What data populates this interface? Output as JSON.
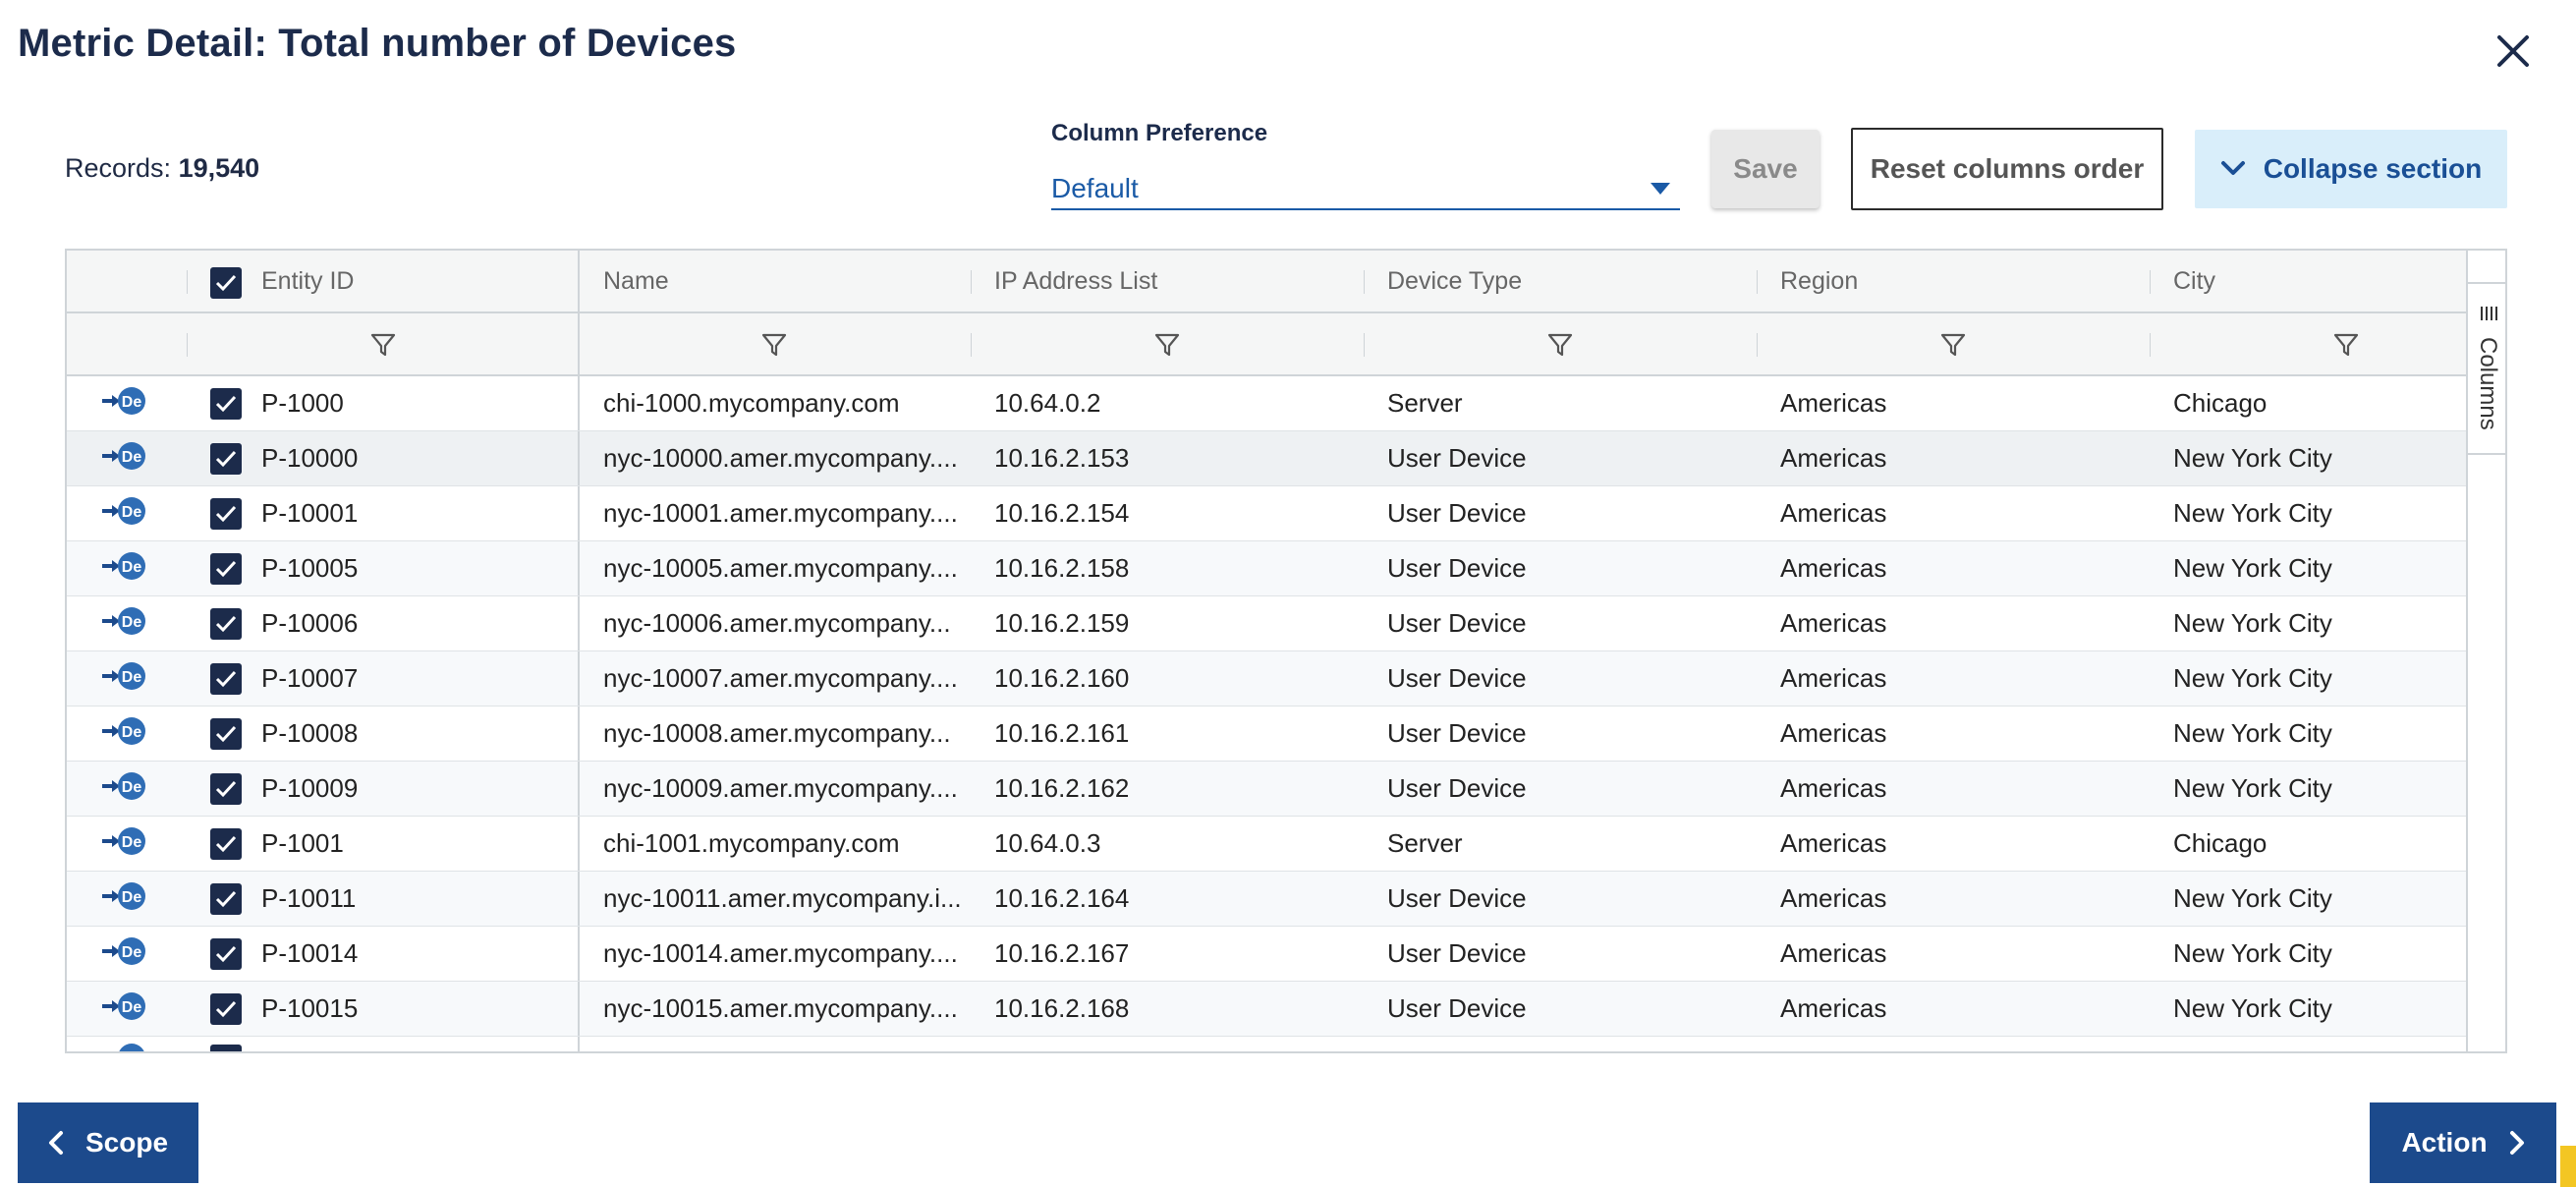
{
  "dialog": {
    "title": "Metric Detail: Total number of Devices",
    "close_icon": "close-icon"
  },
  "records": {
    "label": "Records:",
    "count": "19,540"
  },
  "column_preference": {
    "label": "Column Preference",
    "value": "Default"
  },
  "toolbar": {
    "save_label": "Save",
    "reset_label": "Reset columns order",
    "collapse_label": "Collapse section"
  },
  "grid": {
    "columns": [
      "Entity ID",
      "Name",
      "IP Address List",
      "Device Type",
      "Region",
      "City"
    ],
    "side_panel_label": "Columns",
    "rows": [
      [
        "P-1000",
        "chi-1000.mycompany.com",
        "10.64.0.2",
        "Server",
        "Americas",
        "Chicago"
      ],
      [
        "P-10000",
        "nyc-10000.amer.mycompany....",
        "10.16.2.153",
        "User Device",
        "Americas",
        "New York City"
      ],
      [
        "P-10001",
        "nyc-10001.amer.mycompany....",
        "10.16.2.154",
        "User Device",
        "Americas",
        "New York City"
      ],
      [
        "P-10005",
        "nyc-10005.amer.mycompany....",
        "10.16.2.158",
        "User Device",
        "Americas",
        "New York City"
      ],
      [
        "P-10006",
        "nyc-10006.amer.mycompany...",
        "10.16.2.159",
        "User Device",
        "Americas",
        "New York City"
      ],
      [
        "P-10007",
        "nyc-10007.amer.mycompany....",
        "10.16.2.160",
        "User Device",
        "Americas",
        "New York City"
      ],
      [
        "P-10008",
        "nyc-10008.amer.mycompany...",
        "10.16.2.161",
        "User Device",
        "Americas",
        "New York City"
      ],
      [
        "P-10009",
        "nyc-10009.amer.mycompany....",
        "10.16.2.162",
        "User Device",
        "Americas",
        "New York City"
      ],
      [
        "P-1001",
        "chi-1001.mycompany.com",
        "10.64.0.3",
        "Server",
        "Americas",
        "Chicago"
      ],
      [
        "P-10011",
        "nyc-10011.amer.mycompany.i...",
        "10.16.2.164",
        "User Device",
        "Americas",
        "New York City"
      ],
      [
        "P-10014",
        "nyc-10014.amer.mycompany....",
        "10.16.2.167",
        "User Device",
        "Americas",
        "New York City"
      ],
      [
        "P-10015",
        "nyc-10015.amer.mycompany....",
        "10.16.2.168",
        "User Device",
        "Americas",
        "New York City"
      ]
    ]
  },
  "footer": {
    "scope_label": "Scope",
    "action_label": "Action"
  },
  "colors": {
    "navy": "#1c2b4b",
    "primary": "#1c4a8c",
    "accent_light": "#d9eefa",
    "link": "#1a5aa6"
  }
}
